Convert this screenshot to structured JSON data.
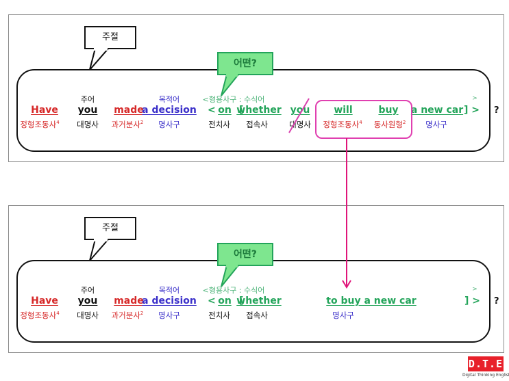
{
  "colors": {
    "red": "#d62828",
    "blue": "#3a2fc9",
    "green": "#23a45a",
    "light_green": "#4fb47a",
    "callout_green": "#7ee68f",
    "pink": "#e040b0",
    "arrow": "#e0157a",
    "logo_red": "#e8202a"
  },
  "top_panel": {
    "callout_main": "주절",
    "callout_which": "어떤?",
    "labels_above": {
      "subject": "주어",
      "object": "목적어",
      "adj_phrase_open": "<형용사구 : 수식어",
      "adj_phrase_close": ">"
    },
    "words": [
      {
        "text": "Have",
        "tag": "정형조동사",
        "sup": "4"
      },
      {
        "text": "you",
        "tag": "대명사"
      },
      {
        "text": "made",
        "tag": "과거분사",
        "sup": "2"
      },
      {
        "text": "a decision",
        "tag": "명사구"
      },
      {
        "prefix": "< ",
        "text": "on",
        "tag": "전치사"
      },
      {
        "prefix": "[ ",
        "text": "whether",
        "tag": "접속사"
      },
      {
        "text": "you",
        "tag": "대명사",
        "struck": true
      },
      {
        "text": "will",
        "tag": "정형조동사",
        "sup": "4"
      },
      {
        "text": "buy",
        "tag": "동사원형",
        "sup": "2"
      },
      {
        "text": "a new car",
        "suffix": " ] >",
        "tag": "명사구"
      }
    ],
    "question_mark": "?"
  },
  "bottom_panel": {
    "callout_main": "주절",
    "callout_which": "어떤?",
    "labels_above": {
      "subject": "주어",
      "object": "목적어",
      "adj_phrase_open": "<형용사구 : 수식어",
      "adj_phrase_close": ">"
    },
    "words": [
      {
        "text": "Have",
        "tag": "정형조동사",
        "sup": "4"
      },
      {
        "text": "you",
        "tag": "대명사"
      },
      {
        "text": "made",
        "tag": "과거분사",
        "sup": "2"
      },
      {
        "text": "a decision",
        "tag": "명사구"
      },
      {
        "prefix": "< ",
        "text": "on",
        "tag": "전치사"
      },
      {
        "prefix": "[ ",
        "text": "whether",
        "tag": "접속사"
      },
      {
        "text": "to buy a new car",
        "tag": "명사구"
      },
      {
        "text": "] >"
      }
    ],
    "question_mark": "?"
  },
  "logo": {
    "text": "D.T.E",
    "subtitle": "Digital Thinking English"
  }
}
